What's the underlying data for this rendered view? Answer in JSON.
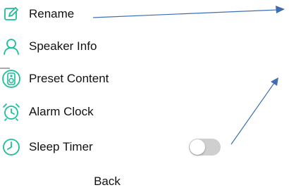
{
  "menu": {
    "items": [
      {
        "label": "Rename",
        "icon": "edit-icon"
      },
      {
        "label": "Speaker Info",
        "icon": "person-icon"
      },
      {
        "label": "Preset Content",
        "icon": "speaker-icon"
      },
      {
        "label": "Alarm Clock",
        "icon": "alarm-clock-icon"
      },
      {
        "label": "Sleep Timer",
        "icon": "clock-icon"
      }
    ],
    "sleep_timer_enabled": false
  },
  "back_label": "Back",
  "colors": {
    "accent": "#1bbf9a",
    "annotation_arrow": "#3d6fb0",
    "toggle_off": "#cfcfcf"
  }
}
